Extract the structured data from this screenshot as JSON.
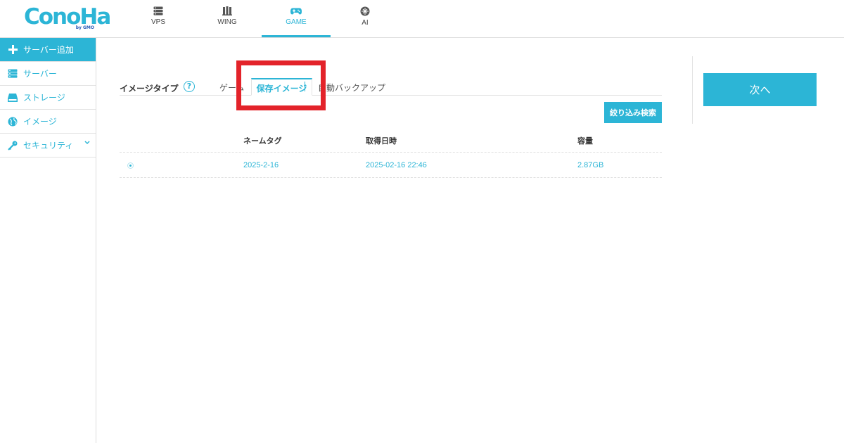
{
  "brand": {
    "logo_text": "ConoHa",
    "logo_sub": "by GMO"
  },
  "service_tabs": [
    {
      "label": "VPS",
      "icon": "server-icon",
      "active": false
    },
    {
      "label": "WING",
      "icon": "wing-icon",
      "active": false
    },
    {
      "label": "GAME",
      "icon": "gamepad-icon",
      "active": true
    },
    {
      "label": "AI",
      "icon": "ai-chip-icon",
      "active": false
    }
  ],
  "sidebar": {
    "items": [
      {
        "label": "サーバー追加",
        "icon": "plus-icon"
      },
      {
        "label": "サーバー",
        "icon": "server-icon"
      },
      {
        "label": "ストレージ",
        "icon": "storage-icon"
      },
      {
        "label": "イメージ",
        "icon": "globe-icon"
      },
      {
        "label": "セキュリティ",
        "icon": "key-icon"
      }
    ]
  },
  "image_type": {
    "label": "イメージタイプ",
    "help": "?",
    "tabs": [
      {
        "label": "ゲーム",
        "active": false
      },
      {
        "label": "保存イメージ",
        "active": true
      },
      {
        "label": "自動バックアップ",
        "active": false
      }
    ]
  },
  "filter_button": "絞り込み検索",
  "table": {
    "headers": [
      "ネームタグ",
      "取得日時",
      "容量"
    ],
    "rows": [
      {
        "name_tag": "2025-2-16",
        "acquired": "2025-02-16 22:46",
        "size": "2.87GB",
        "selected": true
      }
    ]
  },
  "next_button": "次へ",
  "colors": {
    "accent": "#2cb5d6",
    "highlight": "#e3232a"
  }
}
